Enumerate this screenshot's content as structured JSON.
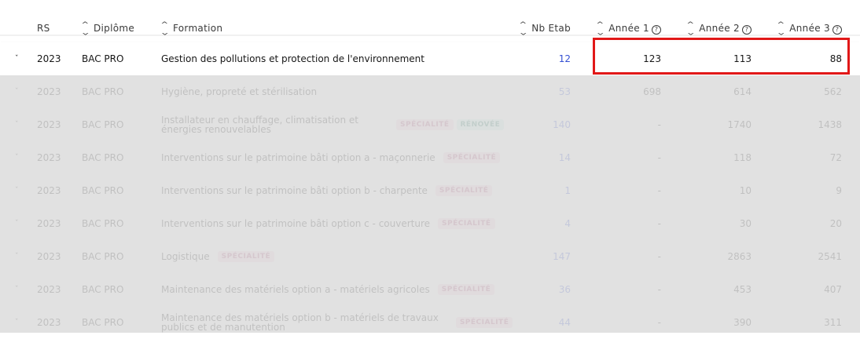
{
  "header": {
    "rs": "RS",
    "diplome": "Diplôme",
    "formation": "Formation",
    "nb_etab": "Nb Etab",
    "annee1": "Année 1",
    "annee2": "Année 2",
    "annee3": "Année 3",
    "help_glyph": "?",
    "sort_icon": "sort-icon"
  },
  "rows": [
    {
      "rs": "2023",
      "diplome": "BAC PRO",
      "formation": "Gestion des pollutions et protection de l'environnement",
      "badges": [],
      "nb": "12",
      "a1": "123",
      "a2": "113",
      "a3": "88",
      "active": true
    },
    {
      "rs": "2023",
      "diplome": "BAC PRO",
      "formation": "Hygiène, propreté et stérilisation",
      "badges": [],
      "nb": "53",
      "a1": "698",
      "a2": "614",
      "a3": "562"
    },
    {
      "rs": "2023",
      "diplome": "BAC PRO",
      "formation_l1": "Installateur en chauffage, climatisation et",
      "formation_l2": "énergies renouvelables",
      "badges": [
        "SPÉCIALITÉ",
        "RÉNOVÉE"
      ],
      "nb": "140",
      "a1": "-",
      "a2": "1740",
      "a3": "1438"
    },
    {
      "rs": "2023",
      "diplome": "BAC PRO",
      "formation": "Interventions sur le patrimoine bâti option a - maçonnerie",
      "badges": [
        "SPÉCIALITÉ"
      ],
      "nb": "14",
      "a1": "-",
      "a2": "118",
      "a3": "72"
    },
    {
      "rs": "2023",
      "diplome": "BAC PRO",
      "formation": "Interventions sur le patrimoine bâti option b - charpente",
      "badges": [
        "SPÉCIALITÉ"
      ],
      "nb": "1",
      "a1": "-",
      "a2": "10",
      "a3": "9"
    },
    {
      "rs": "2023",
      "diplome": "BAC PRO",
      "formation": "Interventions sur le patrimoine bâti option c - couverture",
      "badges": [
        "SPÉCIALITÉ"
      ],
      "nb": "4",
      "a1": "-",
      "a2": "30",
      "a3": "20"
    },
    {
      "rs": "2023",
      "diplome": "BAC PRO",
      "formation": "Logistique",
      "badges": [
        "SPÉCIALITÉ"
      ],
      "nb": "147",
      "a1": "-",
      "a2": "2863",
      "a3": "2541"
    },
    {
      "rs": "2023",
      "diplome": "BAC PRO",
      "formation": "Maintenance des matériels option a - matériels agricoles",
      "badges": [
        "SPÉCIALITÉ"
      ],
      "nb": "36",
      "a1": "-",
      "a2": "453",
      "a3": "407"
    },
    {
      "rs": "2023",
      "diplome": "BAC PRO",
      "formation_l1": "Maintenance des matériels option b - matériels de travaux",
      "formation_l2": "publics et de manutention",
      "badges": [
        "SPÉCIALITÉ"
      ],
      "nb": "44",
      "a1": "-",
      "a2": "390",
      "a3": "311"
    }
  ],
  "colors": {
    "highlight": "#e11818",
    "link": "#3550d3",
    "badge_specialite_bg": "#f5d6e4",
    "badge_renovee_bg": "#cdeee6"
  }
}
